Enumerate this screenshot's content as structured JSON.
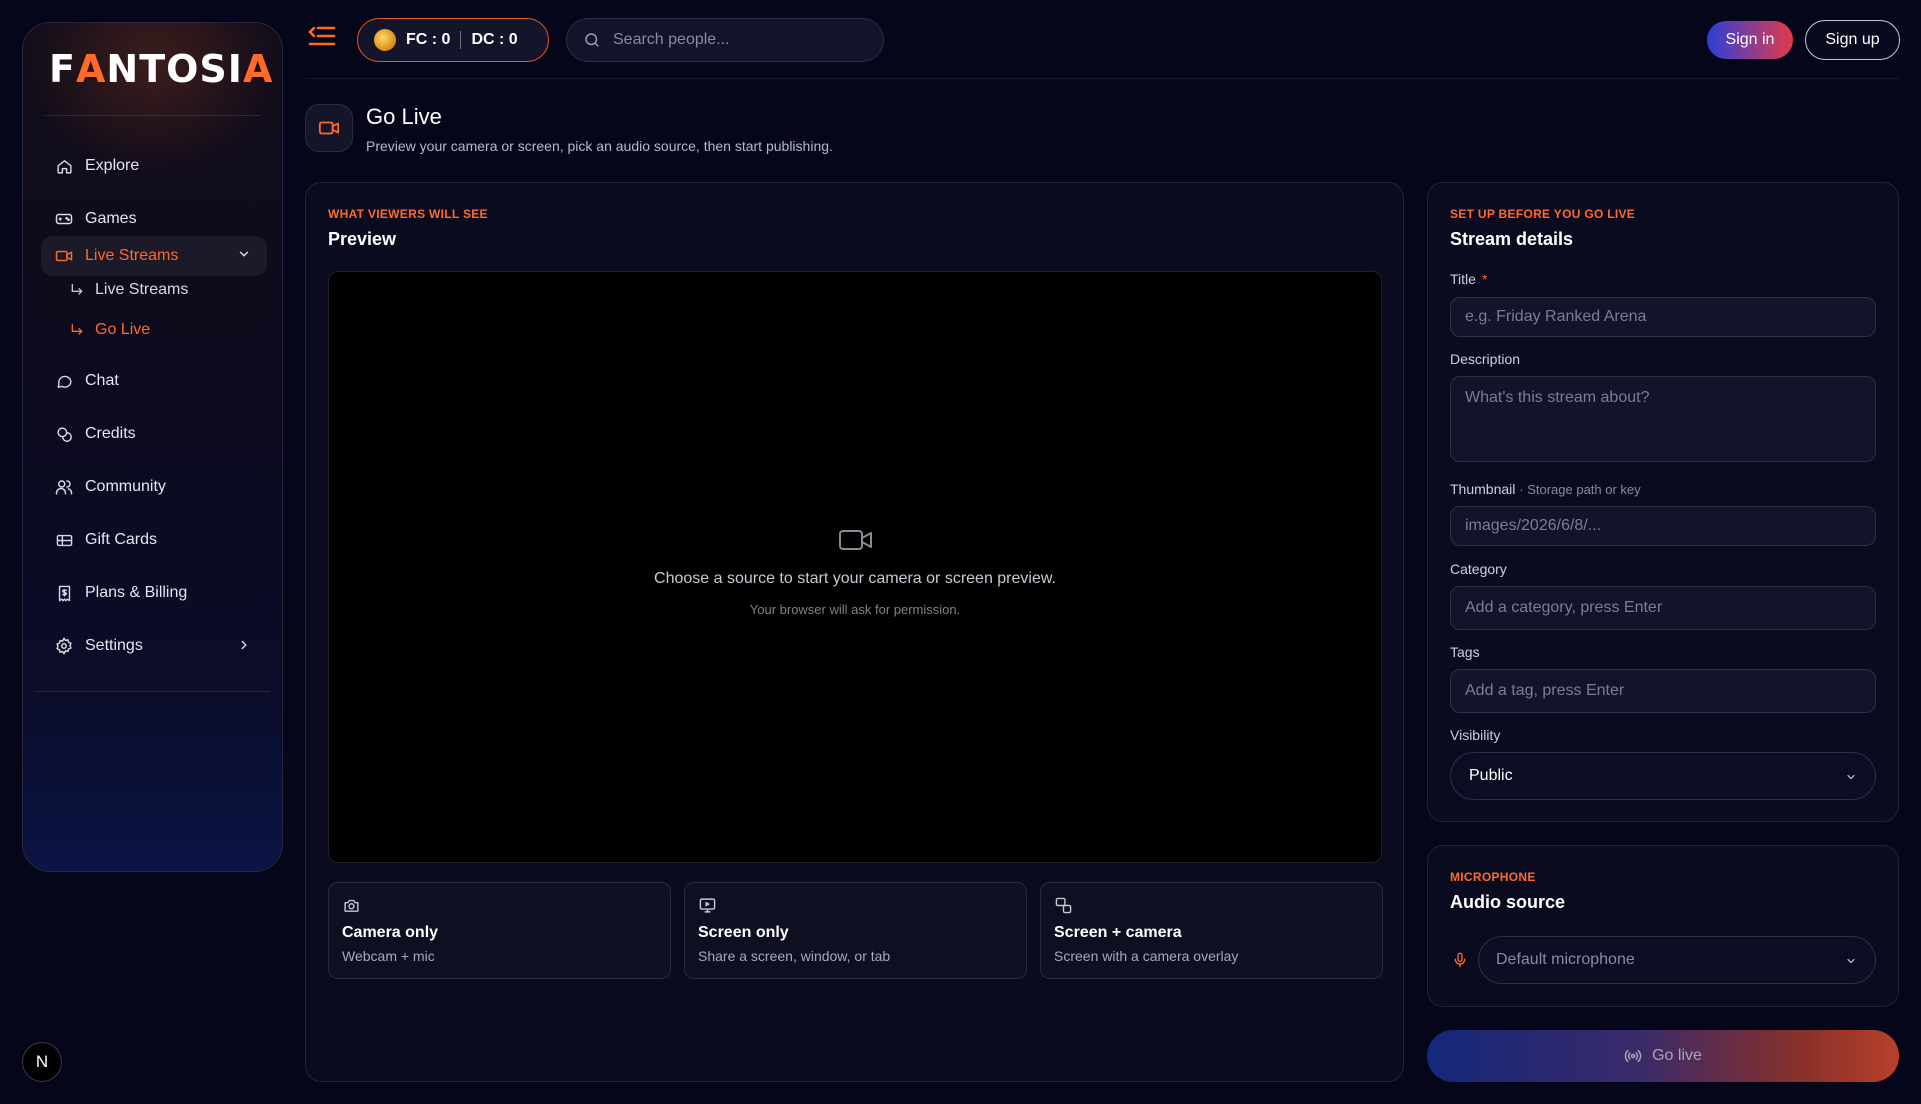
{
  "brand": {
    "name_part1": "F",
    "name_accent1": "A",
    "name_part2": "NTOSI",
    "name_accent2": "A"
  },
  "colors": {
    "accent": "#ff6a2b",
    "background": "#06061a",
    "signin_gradient": [
      "#2d3fd8",
      "#e23a4a"
    ]
  },
  "sidebar": {
    "items": [
      {
        "label": "Explore",
        "icon": "home-icon"
      },
      {
        "label": "Games",
        "icon": "gamepad-icon"
      },
      {
        "label": "Live Streams",
        "icon": "video-icon",
        "active": true,
        "expanded": true
      },
      {
        "label": "Chat",
        "icon": "chat-bubble-icon"
      },
      {
        "label": "Credits",
        "icon": "coins-icon"
      },
      {
        "label": "Community",
        "icon": "users-icon"
      },
      {
        "label": "Gift Cards",
        "icon": "gift-card-icon"
      },
      {
        "label": "Plans & Billing",
        "icon": "receipt-icon"
      },
      {
        "label": "Settings",
        "icon": "gear-icon"
      }
    ],
    "sub_items": [
      {
        "label": "Live Streams"
      },
      {
        "label": "Go Live",
        "active": true
      }
    ]
  },
  "topbar": {
    "fc": "FC : 0",
    "dc": "DC : 0",
    "search_placeholder": "Search people...",
    "sign_in": "Sign in",
    "sign_up": "Sign up"
  },
  "header": {
    "title": "Go Live",
    "subtitle": "Preview your camera or screen, pick an audio source, then start publishing."
  },
  "preview": {
    "eyebrow": "WHAT VIEWERS WILL SEE",
    "title": "Preview",
    "message": "Choose a source to start your camera or screen preview.",
    "hint": "Your browser will ask for permission.",
    "sources": [
      {
        "name": "Camera only",
        "desc": "Webcam + mic",
        "icon": "camera-icon"
      },
      {
        "name": "Screen only",
        "desc": "Share a screen, window, or tab",
        "icon": "monitor-icon"
      },
      {
        "name": "Screen + camera",
        "desc": "Screen with a camera overlay",
        "icon": "screen-camera-icon"
      }
    ]
  },
  "details": {
    "eyebrow": "SET UP BEFORE YOU GO LIVE",
    "title": "Stream details",
    "title_label": "Title",
    "title_required": "*",
    "title_placeholder": "e.g. Friday Ranked Arena",
    "description_label": "Description",
    "description_placeholder": "What's this stream about?",
    "thumbnail_label": "Thumbnail",
    "thumbnail_hint": "· Storage path or key",
    "thumbnail_placeholder": "images/2026/6/8/...",
    "category_label": "Category",
    "category_placeholder": "Add a category, press Enter",
    "tags_label": "Tags",
    "tags_placeholder": "Add a tag, press Enter",
    "visibility_label": "Visibility",
    "visibility_value": "Public"
  },
  "audio": {
    "eyebrow": "MICROPHONE",
    "title": "Audio source",
    "value": "Default microphone"
  },
  "go_live_label": "Go live",
  "badge": "N"
}
